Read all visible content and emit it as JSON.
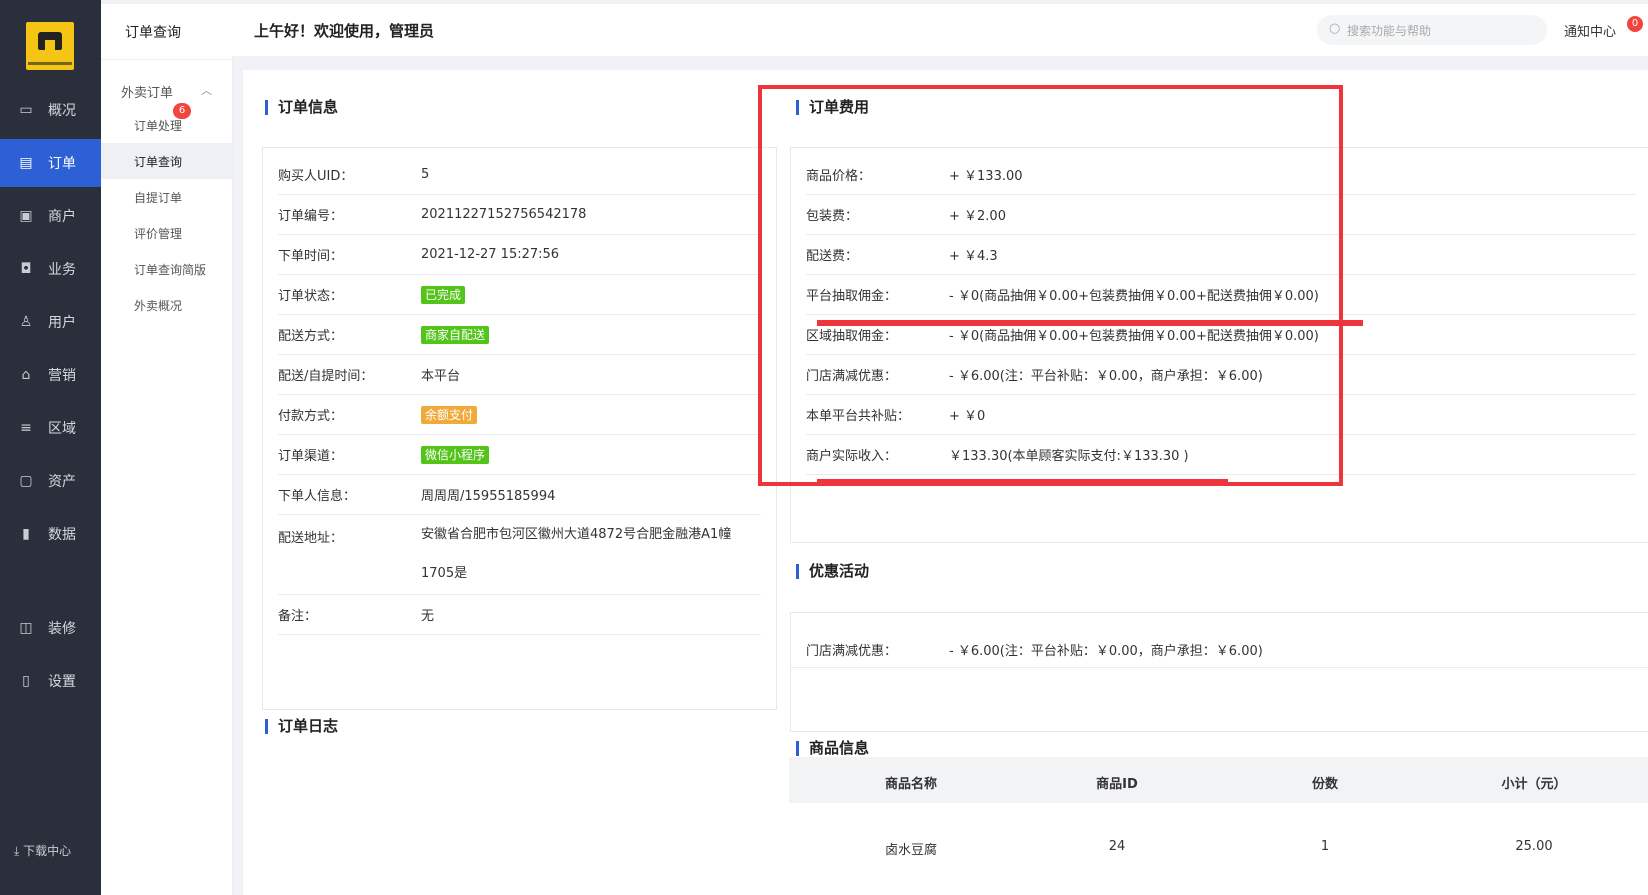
{
  "nav": {
    "items": [
      {
        "label": "概况",
        "icon": "monitor-icon"
      },
      {
        "label": "订单",
        "icon": "document-icon"
      },
      {
        "label": "商户",
        "icon": "store-icon"
      },
      {
        "label": "业务",
        "icon": "business-icon"
      },
      {
        "label": "用户",
        "icon": "user-icon"
      },
      {
        "label": "营销",
        "icon": "marketing-icon"
      },
      {
        "label": "区域",
        "icon": "database-icon"
      },
      {
        "label": "资产",
        "icon": "wallet-icon"
      },
      {
        "label": "数据",
        "icon": "bar-chart-icon"
      },
      {
        "label": "装修",
        "icon": "bag-icon"
      },
      {
        "label": "设置",
        "icon": "settings-icon"
      }
    ],
    "download": "下载中心"
  },
  "subnav": {
    "title": "订单查询",
    "group": "外卖订单",
    "badge": "6",
    "items": [
      "订单处理",
      "订单查询",
      "自提订单",
      "评价管理",
      "订单查询简版",
      "外卖概况"
    ]
  },
  "header": {
    "greeting": "上午好！欢迎使用，管理员",
    "search_placeholder": "搜索功能与帮助",
    "notify": "通知中心",
    "notify_badge": "0"
  },
  "order_info": {
    "title": "订单信息",
    "rows": [
      {
        "k": "购买人UID：",
        "v": "5"
      },
      {
        "k": "订单编号：",
        "v": "20211227152756542178"
      },
      {
        "k": "下单时间：",
        "v": "2021-12-27 15:27:56"
      },
      {
        "k": "订单状态：",
        "v": "已完成"
      },
      {
        "k": "配送方式：",
        "v": "商家自配送"
      },
      {
        "k": "配送/自提时间：",
        "v": "本平台"
      },
      {
        "k": "付款方式：",
        "v": "余额支付"
      },
      {
        "k": "订单渠道：",
        "v": "微信小程序"
      },
      {
        "k": "下单人信息：",
        "v": "周周周/15955185994"
      },
      {
        "k": "配送地址：",
        "v": "安徽省合肥市包河区徽州大道4872号合肥金融港A1幢",
        "v2": "1705是"
      },
      {
        "k": "备注：",
        "v": "无"
      }
    ]
  },
  "order_log": {
    "title": "订单日志"
  },
  "order_fee": {
    "title": "订单费用",
    "rows": [
      {
        "k": "商品价格：",
        "v": "+ ￥133.00"
      },
      {
        "k": "包装费：",
        "v": "+ ￥2.00"
      },
      {
        "k": "配送费：",
        "v": "+ ￥4.3"
      },
      {
        "k": "平台抽取佣金：",
        "v": "- ￥0(商品抽佣￥0.00+包装费抽佣￥0.00+配送费抽佣￥0.00)"
      },
      {
        "k": "区域抽取佣金：",
        "v": "- ￥0(商品抽佣￥0.00+包装费抽佣￥0.00+配送费抽佣￥0.00)"
      },
      {
        "k": "门店满减优惠：",
        "v": "- ￥6.00(注：平台补贴：￥0.00，商户承担：￥6.00)"
      },
      {
        "k": "本单平台共补贴：",
        "v": "+ ￥0"
      },
      {
        "k": "商户实际收入：",
        "v": "￥133.30(本单顾客实际支付:￥133.30 )"
      }
    ]
  },
  "promo": {
    "title": "优惠活动",
    "rows": [
      {
        "k": "门店满减优惠：",
        "v": "- ￥6.00(注：平台补贴：￥0.00，商户承担：￥6.00)"
      }
    ]
  },
  "goods": {
    "title": "商品信息",
    "headers": [
      "商品名称",
      "商品ID",
      "份数",
      "小计（元）"
    ],
    "rows": [
      [
        "卤水豆腐",
        "24",
        "1",
        "25.00"
      ]
    ]
  },
  "colors": {
    "primary": "#2d5fd5",
    "highlight": "#f0343c",
    "tag_green": "#52c41a",
    "tag_orange": "#f0a93b",
    "nav_bg": "#2a2f3b"
  }
}
